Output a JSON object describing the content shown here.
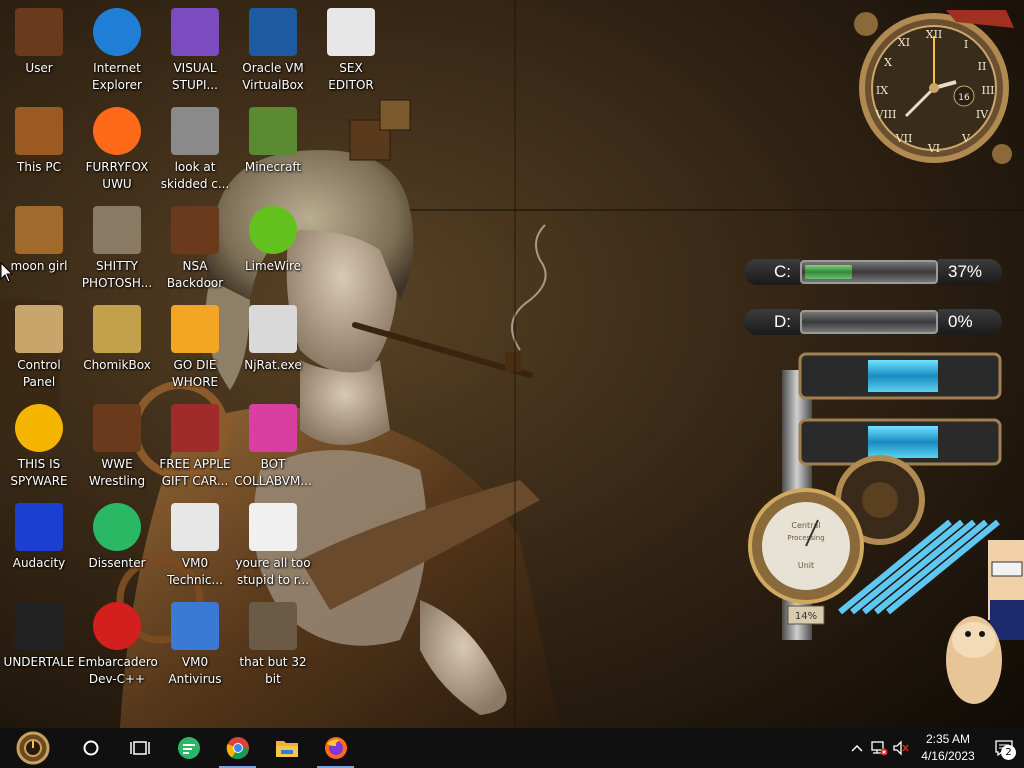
{
  "desktop": {
    "icons": [
      {
        "label": "User",
        "icon": "folder-user-icon",
        "color": "#6b3a1c"
      },
      {
        "label": "Internet\nExplorer",
        "icon": "edge-browser-icon",
        "color": "#1f7fd6"
      },
      {
        "label": "VISUAL\nSTUPI...",
        "icon": "visual-studio-icon",
        "color": "#7b4bbf"
      },
      {
        "label": "Oracle VM\nVirtualBox",
        "icon": "virtualbox-icon",
        "color": "#1d5aa0"
      },
      {
        "label": "SEX\nEDITOR",
        "icon": "hex-editor-icon",
        "color": "#e7e7e7"
      },
      {
        "label": "This PC",
        "icon": "computer-icon",
        "color": "#9a5a22"
      },
      {
        "label": "FURRYFOX\nUWU",
        "icon": "firefox-icon",
        "color": "#ff6a1a"
      },
      {
        "label": "look at\nskidded c...",
        "icon": "copy-files-icon",
        "color": "#8a8a8a"
      },
      {
        "label": "Minecraft",
        "icon": "grass-block-icon",
        "color": "#5b8a32"
      },
      {
        "label": "moon girl",
        "icon": "folder-icon",
        "color": "#a06a2c"
      },
      {
        "label": "SHITTY\nPHOTOSH...",
        "icon": "gimp-icon",
        "color": "#8a7a64"
      },
      {
        "label": "NSA\nBackdoor",
        "icon": "nsa-frame-icon",
        "color": "#6b3a1c"
      },
      {
        "label": "LimeWire",
        "icon": "limewire-icon",
        "color": "#63c11e"
      },
      {
        "label": "Control Panel",
        "icon": "lightbulb-icon",
        "color": "#c7a56b"
      },
      {
        "label": "ChomikBox",
        "icon": "chomikbox-icon",
        "color": "#c3a04b"
      },
      {
        "label": "GO DIE\nWHORE",
        "icon": "dev-editor-icon",
        "color": "#f2a623"
      },
      {
        "label": "NjRat.exe",
        "icon": "skull-icon",
        "color": "#d9d9d9"
      },
      {
        "label": "THIS IS\nSPYWARE",
        "icon": "chrome-canary-icon",
        "color": "#f5b400"
      },
      {
        "label": "WWE\nWrestling",
        "icon": "tv-folder-icon",
        "color": "#6b3a1c"
      },
      {
        "label": "FREE APPLE\nGIFT CAR...",
        "icon": "gear-red-icon",
        "color": "#a02b2b"
      },
      {
        "label": "BOT\nCOLLABVM...",
        "icon": "monitor-icon",
        "color": "#d93fa0"
      },
      {
        "label": "Audacity",
        "icon": "audacity-icon",
        "color": "#1a3fd1"
      },
      {
        "label": "Dissenter",
        "icon": "dissenter-icon",
        "color": "#2ab865"
      },
      {
        "label": "VM0\nTechnic...",
        "icon": "technician-icon",
        "color": "#e7e7e7"
      },
      {
        "label": "youre all too\nstupid to r...",
        "icon": "portrait-icon",
        "color": "#f0f0f0"
      },
      {
        "label": "UNDERTALE",
        "icon": "unity-icon",
        "color": "#222222"
      },
      {
        "label": "Embarcadero\nDev-C++",
        "icon": "devcpp-icon",
        "color": "#d41f1f"
      },
      {
        "label": "VM0\nAntivirus",
        "icon": "shield-icon",
        "color": "#3a7ad6"
      },
      {
        "label": "that but 32\nbit",
        "icon": "portrait-painting-icon",
        "color": "#6b5a45"
      }
    ]
  },
  "widgets": {
    "clock": {
      "hour_numeral": "16"
    },
    "drives": [
      {
        "letter": "C:",
        "percent_label": "37%",
        "fill": 0.37
      },
      {
        "letter": "D:",
        "percent_label": "0%",
        "fill": 0.0
      }
    ],
    "gauge": {
      "top": "Central",
      "mid": "Processing",
      "bottom": "Unit",
      "value_label": "14%"
    }
  },
  "taskbar": {
    "items": [
      {
        "name": "start-button",
        "icon": "steampunk-start-icon"
      },
      {
        "name": "search-button",
        "icon": "cortana-circle-icon"
      },
      {
        "name": "task-view-button",
        "icon": "task-view-icon"
      },
      {
        "name": "dissenter-taskbar",
        "icon": "dissenter-icon"
      },
      {
        "name": "chrome-taskbar",
        "icon": "chrome-icon"
      },
      {
        "name": "file-explorer-taskbar",
        "icon": "folder-icon"
      },
      {
        "name": "firefox-taskbar",
        "icon": "firefox-icon"
      }
    ],
    "tray": {
      "time": "2:35 AM",
      "date": "4/16/2023",
      "notification_count": "2"
    }
  }
}
